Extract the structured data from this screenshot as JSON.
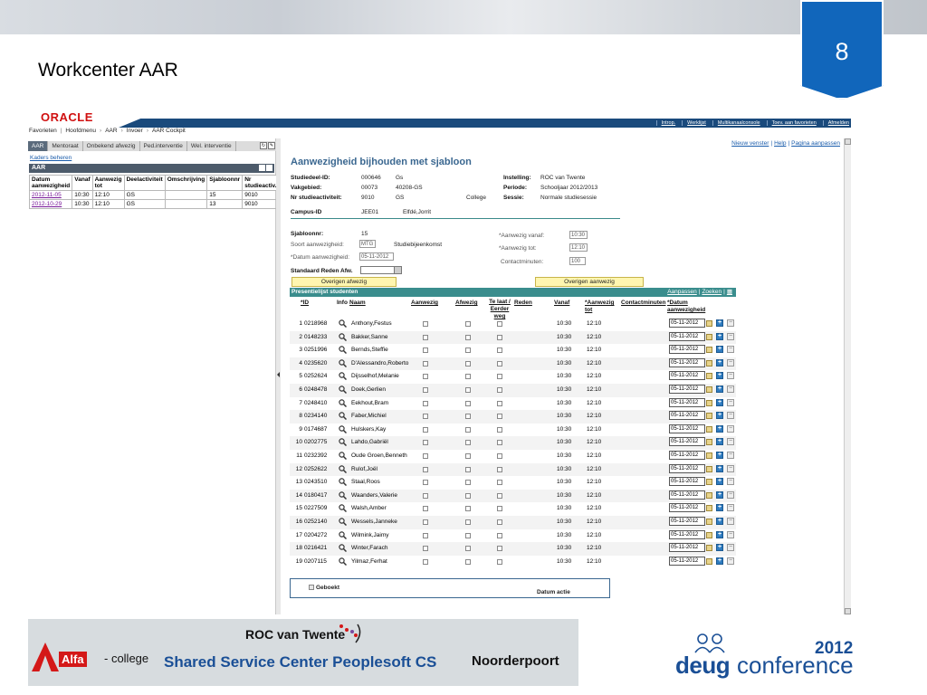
{
  "slide": {
    "number": "8",
    "title": "Workcenter AAR"
  },
  "app": {
    "logo": "ORACLE",
    "top_links": [
      "Introp.",
      "Werklijst",
      "Multikanaalconsole",
      "Toev. aan favorieten",
      "Afmelden"
    ],
    "breadcrumb": [
      "Favorieten",
      "Hoofdmenu",
      "AAR",
      "Invoer",
      "AAR Cockpit"
    ]
  },
  "left": {
    "tabs": [
      "AAR",
      "Mentoraat",
      "Onbekend afwezig",
      "Ped.interventie",
      "Wel. interventie"
    ],
    "kaders": "Kaders beheren",
    "panel_title": "AAR",
    "columns": [
      "Datum aanwezigheid",
      "Vanaf",
      "Aanwezig tot",
      "Deelactiviteit",
      "Omschrijving",
      "Sjabloonnr",
      "Nr studieactiv."
    ],
    "rows": [
      [
        "2012-11-05",
        "10:30",
        "12:10",
        "GS",
        "",
        "15",
        "9010"
      ],
      [
        "2012-10-29",
        "10:30",
        "12:10",
        "GS",
        "",
        "13",
        "9010"
      ]
    ]
  },
  "right": {
    "links": [
      "Nieuw venster",
      "Help",
      "Pagina aanpassen"
    ],
    "title": "Aanwezigheid bijhouden met sjabloon",
    "info": {
      "studiedeel_label": "Studiedeel-ID:",
      "studiedeel_val": "000646",
      "studiedeel_val2": "Gs",
      "vakgebied_label": "Vakgebied:",
      "vakgebied_val": "00073",
      "vakgebied_val2": "40208-GS",
      "nrstud_label": "Nr studieactiviteit:",
      "nrstud_val": "9010",
      "nrstud_val2": "GS",
      "nrstud_val3": "College",
      "inst_label": "Instelling:",
      "inst_val": "ROC van Twente",
      "periode_label": "Periode:",
      "periode_val": "Schooljaar 2012/2013",
      "sessie_label": "Sessie:",
      "sessie_val": "Normale studiesessie",
      "campus_label": "Campus-ID",
      "campus_val": "JEE01",
      "campus_val2": "Elfdé,Jorrit"
    },
    "form": {
      "sjabloon_label": "Sjabloonnr:",
      "sjabloon_val": "15",
      "soort_label": "Soort aanwezigheid:",
      "soort_val": "MTG",
      "soort_desc": "Studiebijeenkomst",
      "datum_label": "*Datum aanwezigheid:",
      "datum_val": "05-11-2012",
      "standaard_label": "Standaard Reden Afw.",
      "vanaf_label": "*Aanwezig vanaf:",
      "vanaf_val": "10:30",
      "tot_label": "*Aanwezig tot:",
      "tot_val": "12:10",
      "contact_label": "Contactminuten:",
      "contact_val": "100",
      "btn_afwezig": "Overigen afwezig",
      "btn_aanwezig": "Overigen aanwezig"
    },
    "grid": {
      "title": "Presentielijst studenten",
      "links": [
        "Aanpassen",
        "Zoeken"
      ],
      "headers": {
        "id": "*ID",
        "info": "Info",
        "naam": "Naam",
        "aanwezig": "Aanwezig",
        "afwezig": "Afwezig",
        "telaat": "Te laat / Eerder weg",
        "reden": "Reden",
        "vanaf": "Vanaf",
        "aanwtot": "*Aanwezig tot",
        "contact": "Contactminuten",
        "datum": "*Datum aanwezigheid"
      },
      "rows": [
        {
          "n": "1",
          "id": "0218968",
          "naam": "Anthony,Festus",
          "vanaf": "10:30",
          "tot": "12:10",
          "datum": "05-11-2012"
        },
        {
          "n": "2",
          "id": "0148233",
          "naam": "Bakker,Sanne",
          "vanaf": "10:30",
          "tot": "12:10",
          "datum": "05-11-2012"
        },
        {
          "n": "3",
          "id": "0251996",
          "naam": "Bernds,Steffie",
          "vanaf": "10:30",
          "tot": "12:10",
          "datum": "05-11-2012"
        },
        {
          "n": "4",
          "id": "0235620",
          "naam": "D'Alessandro,Roberto",
          "vanaf": "10:30",
          "tot": "12:10",
          "datum": "05-11-2012"
        },
        {
          "n": "5",
          "id": "0252624",
          "naam": "Dijsselhof,Melanie",
          "vanaf": "10:30",
          "tot": "12:10",
          "datum": "05-11-2012"
        },
        {
          "n": "6",
          "id": "0248478",
          "naam": "Doek,Gerlien",
          "vanaf": "10:30",
          "tot": "12:10",
          "datum": "05-11-2012"
        },
        {
          "n": "7",
          "id": "0248410",
          "naam": "Eekhout,Bram",
          "vanaf": "10:30",
          "tot": "12:10",
          "datum": "05-11-2012"
        },
        {
          "n": "8",
          "id": "0234140",
          "naam": "Faber,Michiel",
          "vanaf": "10:30",
          "tot": "12:10",
          "datum": "05-11-2012"
        },
        {
          "n": "9",
          "id": "0174687",
          "naam": "Hulskers,Kay",
          "vanaf": "10:30",
          "tot": "12:10",
          "datum": "05-11-2012"
        },
        {
          "n": "10",
          "id": "0202775",
          "naam": "Lahdo,Gabriël",
          "vanaf": "10:30",
          "tot": "12:10",
          "datum": "05-11-2012"
        },
        {
          "n": "11",
          "id": "0232392",
          "naam": "Oude Groen,Benneth",
          "vanaf": "10:30",
          "tot": "12:10",
          "datum": "05-11-2012"
        },
        {
          "n": "12",
          "id": "0252622",
          "naam": "Rulof,Joël",
          "vanaf": "10:30",
          "tot": "12:10",
          "datum": "05-11-2012"
        },
        {
          "n": "13",
          "id": "0243510",
          "naam": "Staal,Roos",
          "vanaf": "10:30",
          "tot": "12:10",
          "datum": "05-11-2012"
        },
        {
          "n": "14",
          "id": "0180417",
          "naam": "Waanders,Valerie",
          "vanaf": "10:30",
          "tot": "12:10",
          "datum": "05-11-2012"
        },
        {
          "n": "15",
          "id": "0227509",
          "naam": "Walsh,Amber",
          "vanaf": "10:30",
          "tot": "12:10",
          "datum": "05-11-2012"
        },
        {
          "n": "16",
          "id": "0252140",
          "naam": "Wessels,Janneke",
          "vanaf": "10:30",
          "tot": "12:10",
          "datum": "05-11-2012"
        },
        {
          "n": "17",
          "id": "0204272",
          "naam": "Wilmink,Jaimy",
          "vanaf": "10:30",
          "tot": "12:10",
          "datum": "05-11-2012"
        },
        {
          "n": "18",
          "id": "0216421",
          "naam": "Winter,Farach",
          "vanaf": "10:30",
          "tot": "12:10",
          "datum": "05-11-2012"
        },
        {
          "n": "19",
          "id": "0207115",
          "naam": "Yilmaz,Ferhat",
          "vanaf": "10:30",
          "tot": "12:10",
          "datum": "05-11-2012"
        }
      ]
    },
    "footer": {
      "geboekt": "Geboekt",
      "datum_actie": "Datum actie"
    }
  },
  "partners": {
    "roc": "ROC van Twente",
    "alfa_box": "Alfa",
    "alfa_text": "- college",
    "ssc": "Shared Service Center Peoplesoft CS",
    "noorderpoort": "Noorderpoort"
  },
  "deug": {
    "year": "2012",
    "word": "deug",
    "conference": "conference"
  }
}
